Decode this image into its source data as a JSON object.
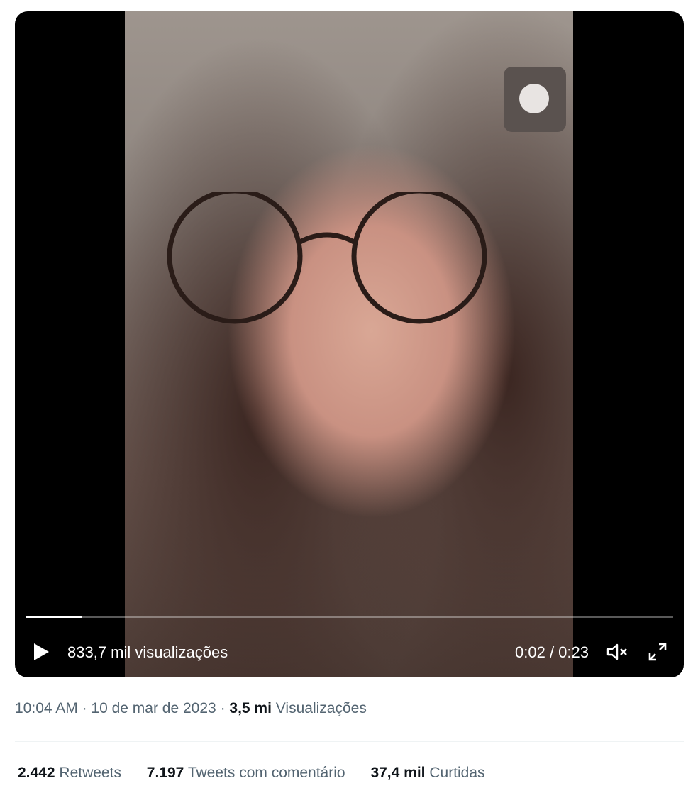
{
  "video": {
    "views_overlay": "833,7 mil visualizações",
    "time": "0:02 / 0:23",
    "progress": 0.087,
    "icons": {
      "play": "play-icon",
      "mute": "volume-muted-icon",
      "fullscreen": "fullscreen-icon"
    }
  },
  "meta": {
    "time": "10:04 AM",
    "separator": "·",
    "date": "10 de mar de 2023",
    "views_count": "3,5 mi",
    "views_label": "Visualizações"
  },
  "stats": [
    {
      "value": "2.442",
      "label": "Retweets"
    },
    {
      "value": "7.197",
      "label": "Tweets com comentário"
    },
    {
      "value": "37,4 mil",
      "label": "Curtidas"
    }
  ],
  "colors": {
    "text_primary": "#0f1419",
    "text_secondary": "#536471",
    "divider": "#eff3f4"
  }
}
